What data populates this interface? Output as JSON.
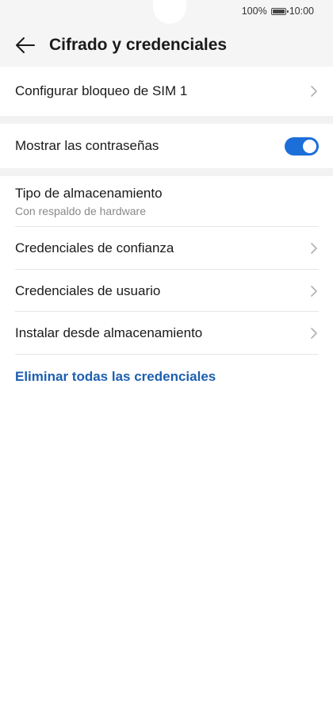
{
  "status_bar": {
    "battery_percent": "100%",
    "time": "10:00",
    "battery_level": 1.0
  },
  "header": {
    "title": "Cifrado y credenciales"
  },
  "sim_section": {
    "sim_lock": {
      "label": "Configurar bloqueo de SIM 1"
    }
  },
  "password_section": {
    "show_passwords": {
      "label": "Mostrar las contraseñas",
      "enabled": true
    }
  },
  "credentials_section": {
    "storage_type": {
      "label": "Tipo de almacenamiento",
      "value": "Con respaldo de hardware"
    },
    "trusted": {
      "label": "Credenciales de confianza"
    },
    "user": {
      "label": "Credenciales de usuario"
    },
    "install": {
      "label": "Instalar desde almacenamiento"
    },
    "clear": {
      "label": "Eliminar todas las credenciales"
    }
  },
  "colors": {
    "accent": "#1c6fd8",
    "link": "#1d5fb0",
    "header_bg": "#f5f5f5"
  },
  "icons": {
    "back": "arrow-left-icon",
    "chevron": "chevron-right-icon",
    "battery": "battery-icon"
  }
}
